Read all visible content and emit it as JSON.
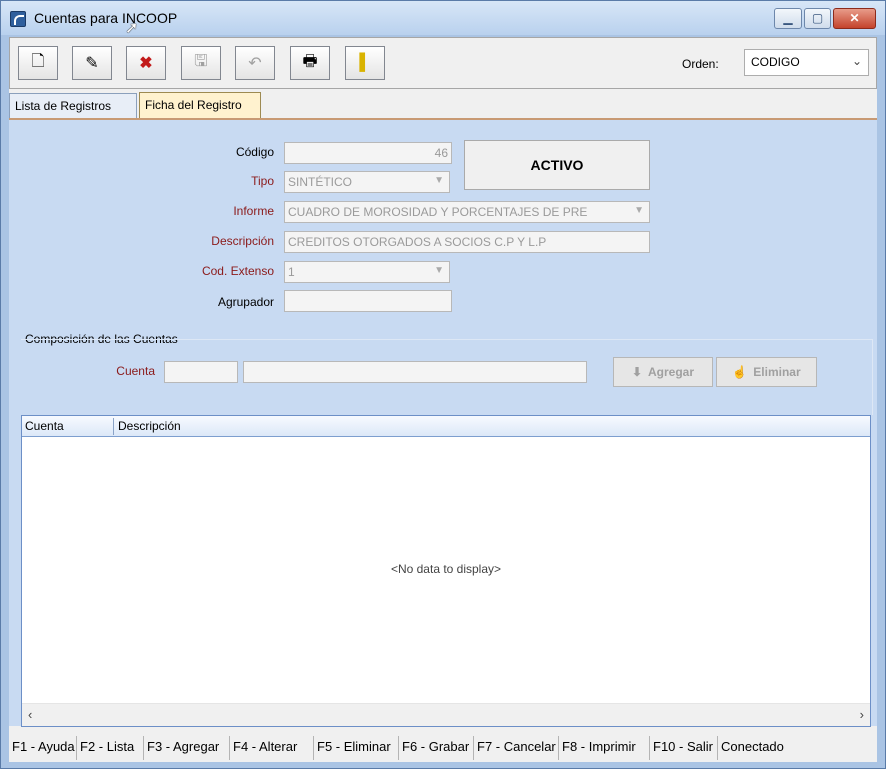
{
  "window": {
    "title": "Cuentas para INCOOP"
  },
  "toolbar": {
    "buttons": [
      {
        "name": "new-button",
        "icon": "new-document-icon",
        "glyph": "🗋",
        "enabled": true
      },
      {
        "name": "edit-button",
        "icon": "edit-document-icon",
        "glyph": "✎",
        "enabled": true
      },
      {
        "name": "delete-button",
        "icon": "delete-icon",
        "glyph": "✖",
        "enabled": true
      },
      {
        "name": "save-button",
        "icon": "save-icon",
        "glyph": "🖫",
        "enabled": false
      },
      {
        "name": "undo-button",
        "icon": "undo-icon",
        "glyph": "↶",
        "enabled": false
      },
      {
        "name": "print-button",
        "icon": "printer-icon",
        "glyph": "🖶",
        "enabled": true
      },
      {
        "name": "exit-button",
        "icon": "exit-door-icon",
        "glyph": "▌",
        "enabled": true
      }
    ],
    "order_label": "Orden:",
    "order_value": "CODIGO"
  },
  "tabs": [
    {
      "label": "Lista de Registros",
      "active": false
    },
    {
      "label": "Ficha del Registro",
      "active": true
    }
  ],
  "form": {
    "codigo_label": "Código",
    "codigo_value": "46",
    "tipo_label": "Tipo",
    "tipo_value": "SINTÉTICO",
    "informe_label": "Informe",
    "informe_value": "CUADRO DE MOROSIDAD Y PORCENTAJES DE PRE",
    "descripcion_label": "Descripción",
    "descripcion_value": "CREDITOS OTORGADOS A SOCIOS C.P Y L.P",
    "cod_extenso_label": "Cod. Extenso",
    "cod_extenso_value": "1",
    "agrupador_label": "Agrupador",
    "agrupador_value": "",
    "status": "ACTIVO"
  },
  "composition": {
    "group_label": "Composición de las Cuentas",
    "cuenta_label": "Cuenta",
    "cuenta_code": "",
    "cuenta_desc": "",
    "add_label": "Agregar",
    "remove_label": "Eliminar"
  },
  "grid": {
    "columns": [
      "Cuenta",
      "Descripción"
    ],
    "empty_text": "<No data to display>"
  },
  "statusbar": [
    "F1 - Ayuda",
    "F2 - Lista",
    "F3 - Agregar",
    "F4 - Alterar",
    "F5 - Eliminar",
    "F6 - Grabar",
    "F7 - Cancelar",
    "F8 - Imprimir",
    "F10 - Salir",
    "Conectado"
  ]
}
